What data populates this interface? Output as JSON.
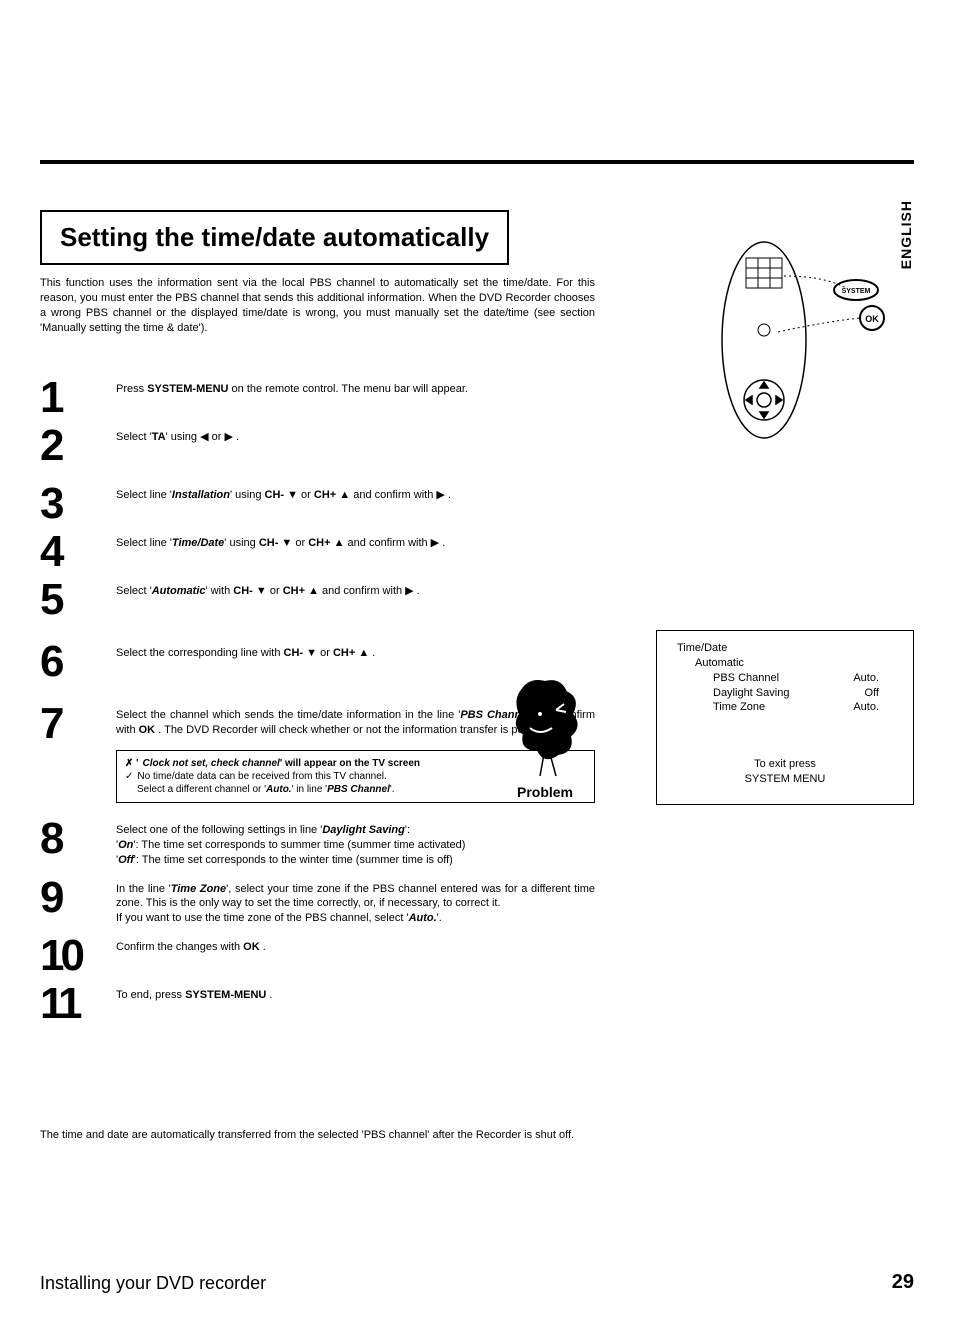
{
  "lang_tab": "ENGLISH",
  "title": "Setting the time/date automatically",
  "intro": "This function uses the information sent via the local PBS channel to automatically set the time/date. For this reason, you must enter the PBS channel that sends this additional information. When the DVD Recorder chooses a wrong PBS channel or the displayed time/date is wrong, you must manually set the date/time (see section 'Manually setting the time & date').",
  "steps": {
    "s1": {
      "num": "1",
      "pre": "Press ",
      "key": "SYSTEM-MENU",
      "post": " on the remote control. The menu bar will appear."
    },
    "s2": {
      "num": "2",
      "pre": "Select '",
      "icon": "TA",
      "post": "' using  ◀  or  ▶ ."
    },
    "s3": {
      "num": "3",
      "pre": "Select line '",
      "opt": "Installation",
      "mid": "' using ",
      "k1": "CH- ▼",
      "or": " or ",
      "k2": "CH+ ▲",
      "post": " and confirm with  ▶ ."
    },
    "s4": {
      "num": "4",
      "pre": "Select line '",
      "opt": "Time/Date",
      "mid": "' using ",
      "k1": "CH- ▼",
      "or": " or ",
      "k2": "CH+ ▲",
      "post": " and confirm with  ▶ ."
    },
    "s5": {
      "num": "5",
      "pre": "Select '",
      "opt": "Automatic",
      "mid": "' with ",
      "k1": "CH- ▼",
      "or": " or ",
      "k2": "CH+ ▲",
      "post": " and confirm with  ▶ ."
    },
    "s6": {
      "num": "6",
      "pre": "Select the corresponding line with ",
      "k1": "CH- ▼",
      "or": " or ",
      "k2": "CH+ ▲",
      "post": " ."
    },
    "s7": {
      "num": "7",
      "pre": "Select the channel which sends the time/date information in the line '",
      "opt": "PBS Channel",
      "mid": "' and confirm with ",
      "k1": "OK",
      "post": " . The DVD Recorder will check whether or not the information transfer is possible."
    },
    "problem": {
      "head_prefix": "✗ '",
      "head_opt": "Clock not set, check channel",
      "head_suffix": "' will appear on the TV screen",
      "line2": "No time/date data can be received from this TV channel.",
      "line3_pre": "Select a different channel or '",
      "line3_opt1": "Auto.",
      "line3_mid": "' in line '",
      "line3_opt2": "PBS Channel",
      "line3_post": "'.",
      "label": "Problem"
    },
    "s8": {
      "num": "8",
      "l1_pre": "Select one of the following settings in line '",
      "l1_opt": "Daylight Saving",
      "l1_post": "':",
      "l2_pre": "'",
      "l2_opt": "On",
      "l2_post": "': The time set corresponds to summer time (summer time activated)",
      "l3_pre": "'",
      "l3_opt": "Off",
      "l3_post": "': The time set corresponds to the winter time (summer time is off)"
    },
    "s9": {
      "num": "9",
      "l1_pre": "In the line '",
      "l1_opt": "Time Zone",
      "l1_post": "', select your time zone if the PBS channel entered was for a different time zone. This is the only way to set the time correctly, or, if necessary, to correct it.",
      "l2_pre": "If you want to use the time zone of the PBS channel, select '",
      "l2_opt": "Auto.",
      "l2_post": "'."
    },
    "s10": {
      "num": "10",
      "pre": "Confirm the changes with ",
      "k1": "OK",
      "post": " ."
    },
    "s11": {
      "num": "11",
      "pre": "To end, press ",
      "k1": "SYSTEM-MENU",
      "post": " ."
    }
  },
  "screen": {
    "title": "Time/Date",
    "sub": "Automatic",
    "rows": [
      {
        "label": "PBS Channel",
        "value": "Auto."
      },
      {
        "label": "Daylight Saving",
        "value": "Off"
      },
      {
        "label": "Time Zone",
        "value": "Auto."
      }
    ],
    "exit1": "To exit press",
    "exit2": "SYSTEM MENU"
  },
  "summary": "The time and date are automatically transferred from the selected 'PBS channel' after the Recorder is shut off.",
  "footer_left": "Installing your DVD recorder",
  "footer_right": "29"
}
